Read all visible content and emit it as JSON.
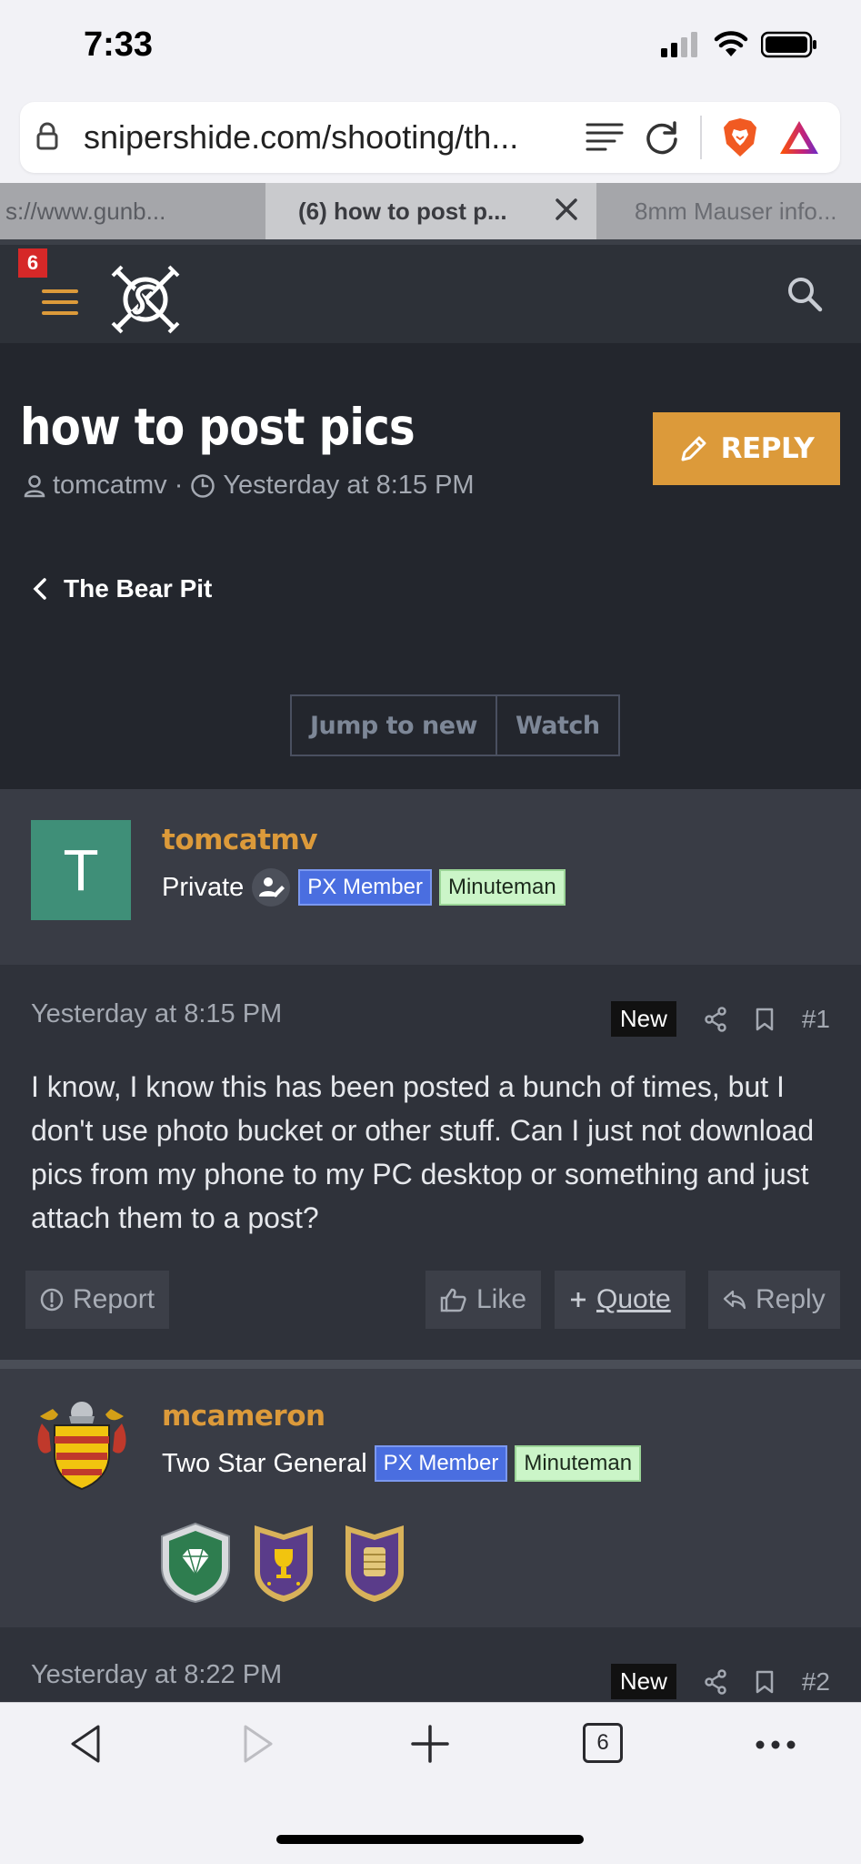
{
  "status": {
    "time": "7:33"
  },
  "url": {
    "text": "snipershide.com/shooting/th..."
  },
  "tabs": [
    {
      "label": "s://www.gunb..."
    },
    {
      "label": "(6) how to post p..."
    },
    {
      "label": "8mm Mauser info..."
    }
  ],
  "header": {
    "notif_count": "6"
  },
  "thread": {
    "title": "how to post pics",
    "author": "tomcatmv",
    "date": "Yesterday at 8:15 PM",
    "reply_label": "REPLY",
    "breadcrumb": "The Bear Pit",
    "jump_label": "Jump to new",
    "watch_label": "Watch"
  },
  "posts": [
    {
      "username": "tomcatmv",
      "avatar_letter": "T",
      "rank": "Private",
      "tags": [
        "PX Member",
        "Minuteman"
      ],
      "date": "Yesterday at 8:15 PM",
      "new_label": "New",
      "number": "#1",
      "body": "I know, I know this has been posted a bunch of times, but I don't use photo bucket or other stuff. Can I just not download pics from my phone to my PC desktop or something and just attach them to a post?",
      "actions": {
        "report": "Report",
        "like": "Like",
        "quote": "Quote",
        "reply": "Reply"
      }
    },
    {
      "username": "mcameron",
      "rank": "Two Star General",
      "tags": [
        "PX Member",
        "Minuteman"
      ],
      "date": "Yesterday at 8:22 PM",
      "new_label": "New",
      "number": "#2"
    }
  ],
  "toolbar": {
    "tab_count": "6"
  },
  "colors": {
    "accent": "#dc9a3a",
    "bg": "#23262d",
    "px_tag": "#4a6ee0",
    "minuteman_tag": "#cbf5c8"
  }
}
